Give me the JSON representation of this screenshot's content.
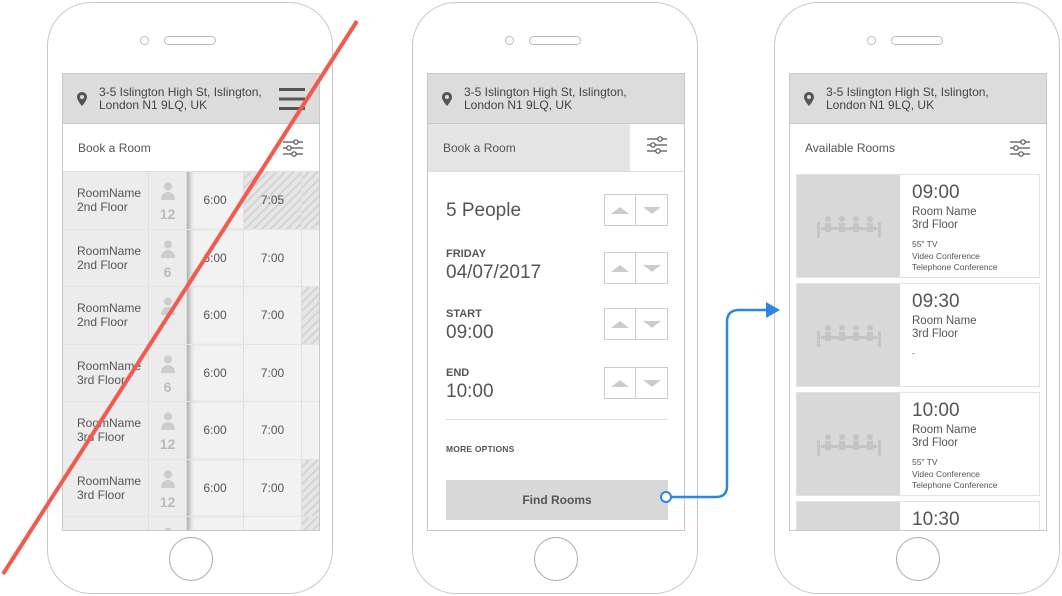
{
  "address": {
    "line1": "3-5 Islington High St, Islington,",
    "line2": "London N1 9LQ, UK"
  },
  "phone1": {
    "title": "Book a Room",
    "rows": [
      {
        "name1": "RoomName",
        "name2": "2nd Floor",
        "cap": "12",
        "t1": "6:00",
        "t2": "7:05",
        "t2hatch": true,
        "t3hatch": false
      },
      {
        "name1": "RoomName",
        "name2": "2nd Floor",
        "cap": "6",
        "t1": "6:00",
        "t2": "7:00",
        "t2hatch": false,
        "t3hatch": false
      },
      {
        "name1": "RoomName",
        "name2": "2nd Floor",
        "cap": "",
        "t1": "6:00",
        "t2": "7:00",
        "t2hatch": false,
        "t3hatch": true
      },
      {
        "name1": "RoomName",
        "name2": "3rd Floor",
        "cap": "6",
        "t1": "6:00",
        "t2": "7:00",
        "t2hatch": false,
        "t3hatch": false
      },
      {
        "name1": "RoomName",
        "name2": "3rd Floor",
        "cap": "12",
        "t1": "6:00",
        "t2": "7:00",
        "t2hatch": false,
        "t3hatch": false
      },
      {
        "name1": "RoomName",
        "name2": "3rd Floor",
        "cap": "12",
        "t1": "6:00",
        "t2": "7:00",
        "t2hatch": false,
        "t3hatch": true
      }
    ]
  },
  "phone2": {
    "title": "Book a Room",
    "people": "5 People",
    "day_label": "FRIDAY",
    "date": "04/07/2017",
    "start_label": "START",
    "start": "09:00",
    "end_label": "END",
    "end": "10:00",
    "more_options": "MORE OPTIONS",
    "find_button": "Find Rooms"
  },
  "phone3": {
    "title": "Available Rooms",
    "cards": [
      {
        "time": "09:00",
        "room": "Room Name",
        "floor": "3rd Floor",
        "features": [
          "55\" TV",
          "Video Conference",
          "Telephone Conference"
        ]
      },
      {
        "time": "09:30",
        "room": "Room Name",
        "floor": "3rd Floor",
        "features": [
          "-"
        ]
      },
      {
        "time": "10:00",
        "room": "Room Name",
        "floor": "3rd Floor",
        "features": [
          "55\" TV",
          "Video Conference",
          "Telephone Conference"
        ]
      },
      {
        "time": "10:30",
        "room": "",
        "floor": "",
        "features": []
      }
    ]
  },
  "colors": {
    "strike": "#f05a50",
    "flow_arrow": "#2f86e0",
    "header_bg": "#dcdcdc"
  },
  "icons": [
    "location-pin-icon",
    "hamburger-menu-icon",
    "filter-sliders-icon",
    "person-icon",
    "meeting-table-icon",
    "chevron-up-icon",
    "chevron-down-icon"
  ]
}
